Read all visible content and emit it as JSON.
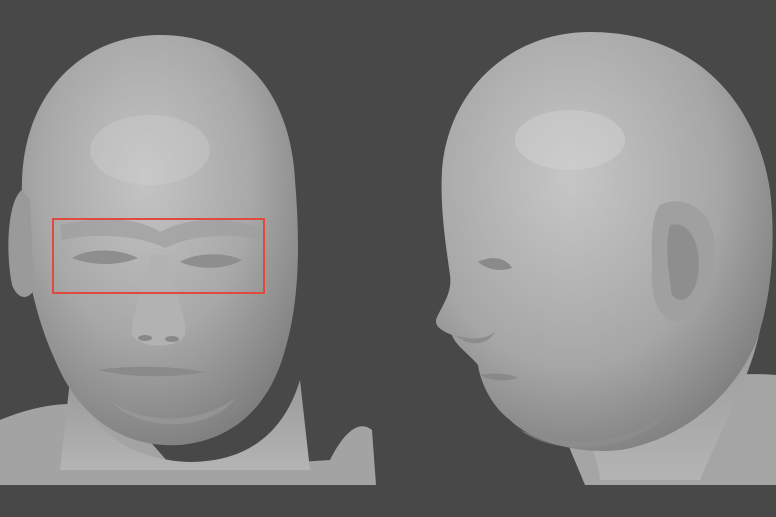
{
  "scene": {
    "background_color": "#484848",
    "model_color": "#a9a9a9",
    "views": [
      {
        "name": "front-view"
      },
      {
        "name": "side-view"
      }
    ]
  },
  "highlight": {
    "color": "#e04a3c",
    "target": "closed-eyes"
  }
}
